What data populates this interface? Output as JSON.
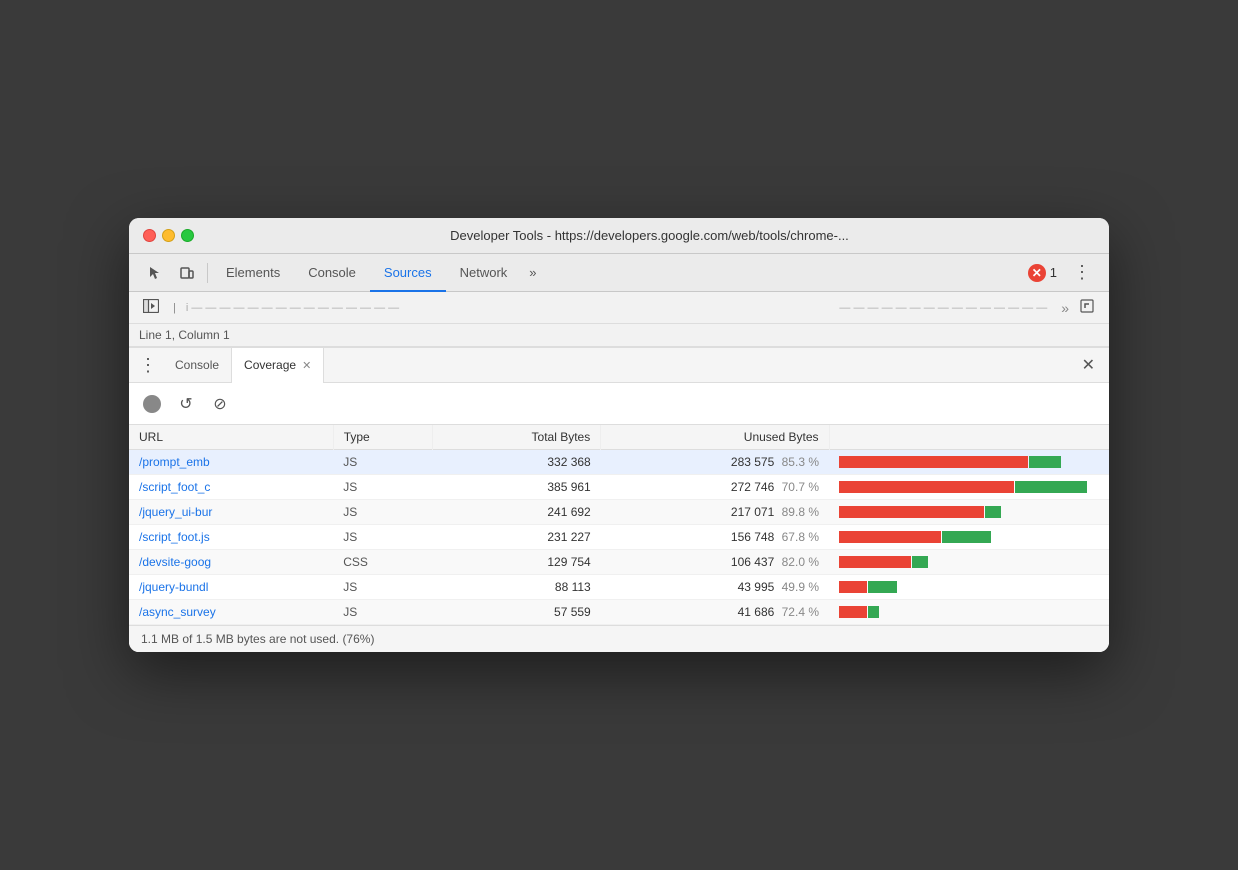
{
  "window": {
    "title": "Developer Tools - https://developers.google.com/web/tools/chrome-..."
  },
  "titlebar": {
    "close_label": "",
    "minimize_label": "",
    "maximize_label": ""
  },
  "tabs": {
    "items": [
      {
        "id": "elements",
        "label": "Elements",
        "active": false
      },
      {
        "id": "console",
        "label": "Console",
        "active": false
      },
      {
        "id": "sources",
        "label": "Sources",
        "active": true
      },
      {
        "id": "network",
        "label": "Network",
        "active": false
      },
      {
        "id": "more",
        "label": "»",
        "active": false
      }
    ],
    "error_count": "1",
    "menu_label": "⋮"
  },
  "sources_toolbar": {
    "breadcrumb": "Line 1, Column 1"
  },
  "drawer": {
    "menu_label": "⋮",
    "tabs": [
      {
        "id": "console",
        "label": "Console",
        "active": false,
        "closeable": false
      },
      {
        "id": "coverage",
        "label": "Coverage",
        "active": true,
        "closeable": true
      }
    ],
    "close_label": "✕"
  },
  "coverage_toolbar": {
    "record_tooltip": "Start recording",
    "refresh_tooltip": "Reload and start recording",
    "clear_tooltip": "Clear all"
  },
  "table": {
    "columns": [
      "URL",
      "Type",
      "Total Bytes",
      "Unused Bytes",
      ""
    ],
    "rows": [
      {
        "url": "/prompt_emb",
        "type": "JS",
        "total_bytes": "332 368",
        "unused_bytes": "283 575",
        "unused_pct": "85.3 %",
        "used_ratio": 0.147,
        "bar_width_ratio": 0.85
      },
      {
        "url": "/script_foot_c",
        "type": "JS",
        "total_bytes": "385 961",
        "unused_bytes": "272 746",
        "unused_pct": "70.7 %",
        "used_ratio": 0.293,
        "bar_width_ratio": 0.95
      },
      {
        "url": "/jquery_ui-bur",
        "type": "JS",
        "total_bytes": "241 692",
        "unused_bytes": "217 071",
        "unused_pct": "89.8 %",
        "used_ratio": 0.102,
        "bar_width_ratio": 0.62
      },
      {
        "url": "/script_foot.js",
        "type": "JS",
        "total_bytes": "231 227",
        "unused_bytes": "156 748",
        "unused_pct": "67.8 %",
        "used_ratio": 0.322,
        "bar_width_ratio": 0.58
      },
      {
        "url": "/devsite-goog",
        "type": "CSS",
        "total_bytes": "129 754",
        "unused_bytes": "106 437",
        "unused_pct": "82.0 %",
        "used_ratio": 0.18,
        "bar_width_ratio": 0.34
      },
      {
        "url": "/jquery-bundl",
        "type": "JS",
        "total_bytes": "88 113",
        "unused_bytes": "43 995",
        "unused_pct": "49.9 %",
        "used_ratio": 0.501,
        "bar_width_ratio": 0.22
      },
      {
        "url": "/async_survey",
        "type": "JS",
        "total_bytes": "57 559",
        "unused_bytes": "41 686",
        "unused_pct": "72.4 %",
        "used_ratio": 0.276,
        "bar_width_ratio": 0.15
      }
    ]
  },
  "footer": {
    "text": "1.1 MB of 1.5 MB bytes are not used. (76%)"
  },
  "colors": {
    "used": "#34a853",
    "unused": "#ea4335",
    "accent": "#1a73e8",
    "active_tab_underline": "#1a73e8"
  }
}
